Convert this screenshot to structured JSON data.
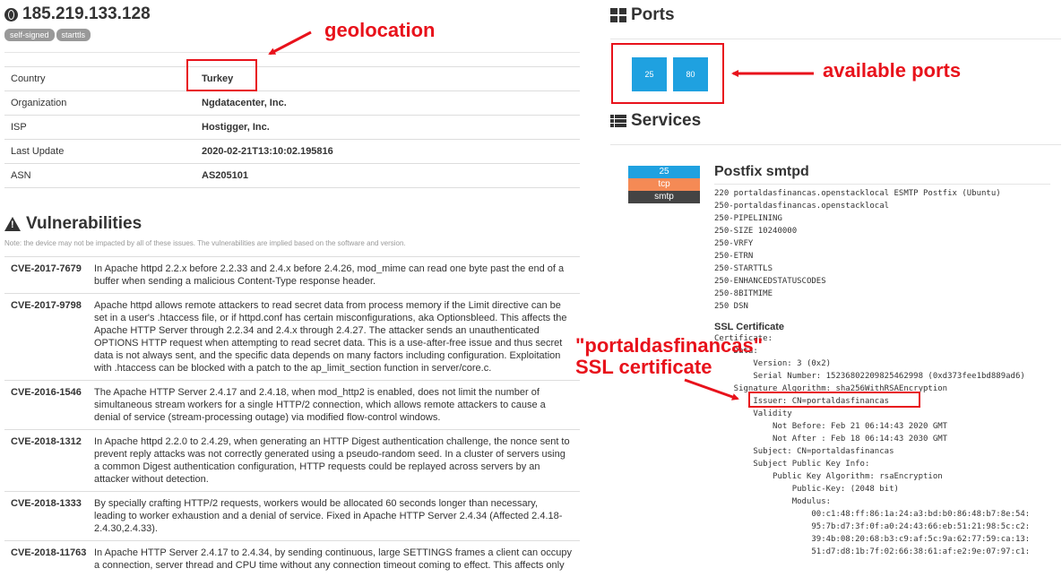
{
  "host": {
    "ip": "185.219.133.128",
    "tags": [
      "self-signed",
      "starttls"
    ]
  },
  "info_rows": [
    {
      "key": "Country",
      "value": "Turkey"
    },
    {
      "key": "Organization",
      "value": "Ngdatacenter, Inc."
    },
    {
      "key": "ISP",
      "value": "Hostigger, Inc."
    },
    {
      "key": "Last Update",
      "value": "2020-02-21T13:10:02.195816"
    },
    {
      "key": "ASN",
      "value": "AS205101"
    }
  ],
  "vulnerabilities": {
    "title": "Vulnerabilities",
    "note": "Note: the device may not be impacted by all of these issues. The vulnerabilities are implied based on the software and version.",
    "items": [
      {
        "cve": "CVE-2017-7679",
        "desc": "In Apache httpd 2.2.x before 2.2.33 and 2.4.x before 2.4.26, mod_mime can read one byte past the end of a buffer when sending a malicious Content-Type response header."
      },
      {
        "cve": "CVE-2017-9798",
        "desc": "Apache httpd allows remote attackers to read secret data from process memory if the Limit directive can be set in a user's .htaccess file, or if httpd.conf has certain misconfigurations, aka Optionsbleed. This affects the Apache HTTP Server through 2.2.34 and 2.4.x through 2.4.27. The attacker sends an unauthenticated OPTIONS HTTP request when attempting to read secret data. This is a use-after-free issue and thus secret data is not always sent, and the specific data depends on many factors including configuration. Exploitation with .htaccess can be blocked with a patch to the ap_limit_section function in server/core.c."
      },
      {
        "cve": "CVE-2016-1546",
        "desc": "The Apache HTTP Server 2.4.17 and 2.4.18, when mod_http2 is enabled, does not limit the number of simultaneous stream workers for a single HTTP/2 connection, which allows remote attackers to cause a denial of service (stream-processing outage) via modified flow-control windows."
      },
      {
        "cve": "CVE-2018-1312",
        "desc": "In Apache httpd 2.2.0 to 2.4.29, when generating an HTTP Digest authentication challenge, the nonce sent to prevent reply attacks was not correctly generated using a pseudo-random seed. In a cluster of servers using a common Digest authentication configuration, HTTP requests could be replayed across servers by an attacker without detection."
      },
      {
        "cve": "CVE-2018-1333",
        "desc": "By specially crafting HTTP/2 requests, workers would be allocated 60 seconds longer than necessary, leading to worker exhaustion and a denial of service. Fixed in Apache HTTP Server 2.4.34 (Affected 2.4.18-2.4.30,2.4.33)."
      },
      {
        "cve": "CVE-2018-11763",
        "desc": "In Apache HTTP Server 2.4.17 to 2.4.34, by sending continuous, large SETTINGS frames a client can occupy a connection, server thread and CPU time without any connection timeout coming to effect. This affects only"
      }
    ]
  },
  "ports": {
    "title": "Ports",
    "list": [
      "25",
      "80"
    ]
  },
  "services": {
    "title": "Services",
    "port": "25",
    "proto": "tcp",
    "name": "smtp",
    "product": "Postfix smtpd",
    "banner": "220 portaldasfinancas.openstacklocal ESMTP Postfix (Ubuntu)\n250-portaldasfinancas.openstacklocal\n250-PIPELINING\n250-SIZE 10240000\n250-VRFY\n250-ETRN\n250-STARTTLS\n250-ENHANCEDSTATUSCODES\n250-8BITMIME\n250 DSN",
    "ssl_title": "SSL Certificate",
    "cert_lines": [
      "Certificate:",
      "    Data:",
      "        Version: 3 (0x2)",
      "        Serial Number: 15236802209825462998 (0xd373fee1bd889ad6)",
      "    Signature Algorithm: sha256WithRSAEncryption",
      "        Issuer: CN=portaldasfinancas",
      "        Validity",
      "            Not Before: Feb 21 06:14:43 2020 GMT",
      "            Not After : Feb 18 06:14:43 2030 GMT",
      "        Subject: CN=portaldasfinancas",
      "        Subject Public Key Info:",
      "            Public Key Algorithm: rsaEncryption",
      "                Public-Key: (2048 bit)",
      "                Modulus:",
      "                    00:c1:48:ff:86:1a:24:a3:bd:b0:86:48:b7:8e:54:",
      "                    95:7b:d7:3f:0f:a0:24:43:66:eb:51:21:98:5c:c2:",
      "                    39:4b:08:20:68:b3:c9:af:5c:9a:62:77:59:ca:13:",
      "                    51:d7:d8:1b:7f:02:66:38:61:af:e2:9e:07:97:c1:"
    ]
  },
  "annotations": {
    "geolocation": "geolocation",
    "available_ports": "available ports",
    "ssl_line1": "\"portaldasfinancas\"",
    "ssl_line2": "SSL certificate"
  },
  "colors": {
    "accent": "#1fa1e0",
    "annotation": "#e8121b",
    "proto": "#f58a55",
    "name_bg": "#444444"
  },
  "icons": [
    "globe-icon",
    "warning-icon",
    "ports-grid-icon",
    "services-list-icon"
  ]
}
